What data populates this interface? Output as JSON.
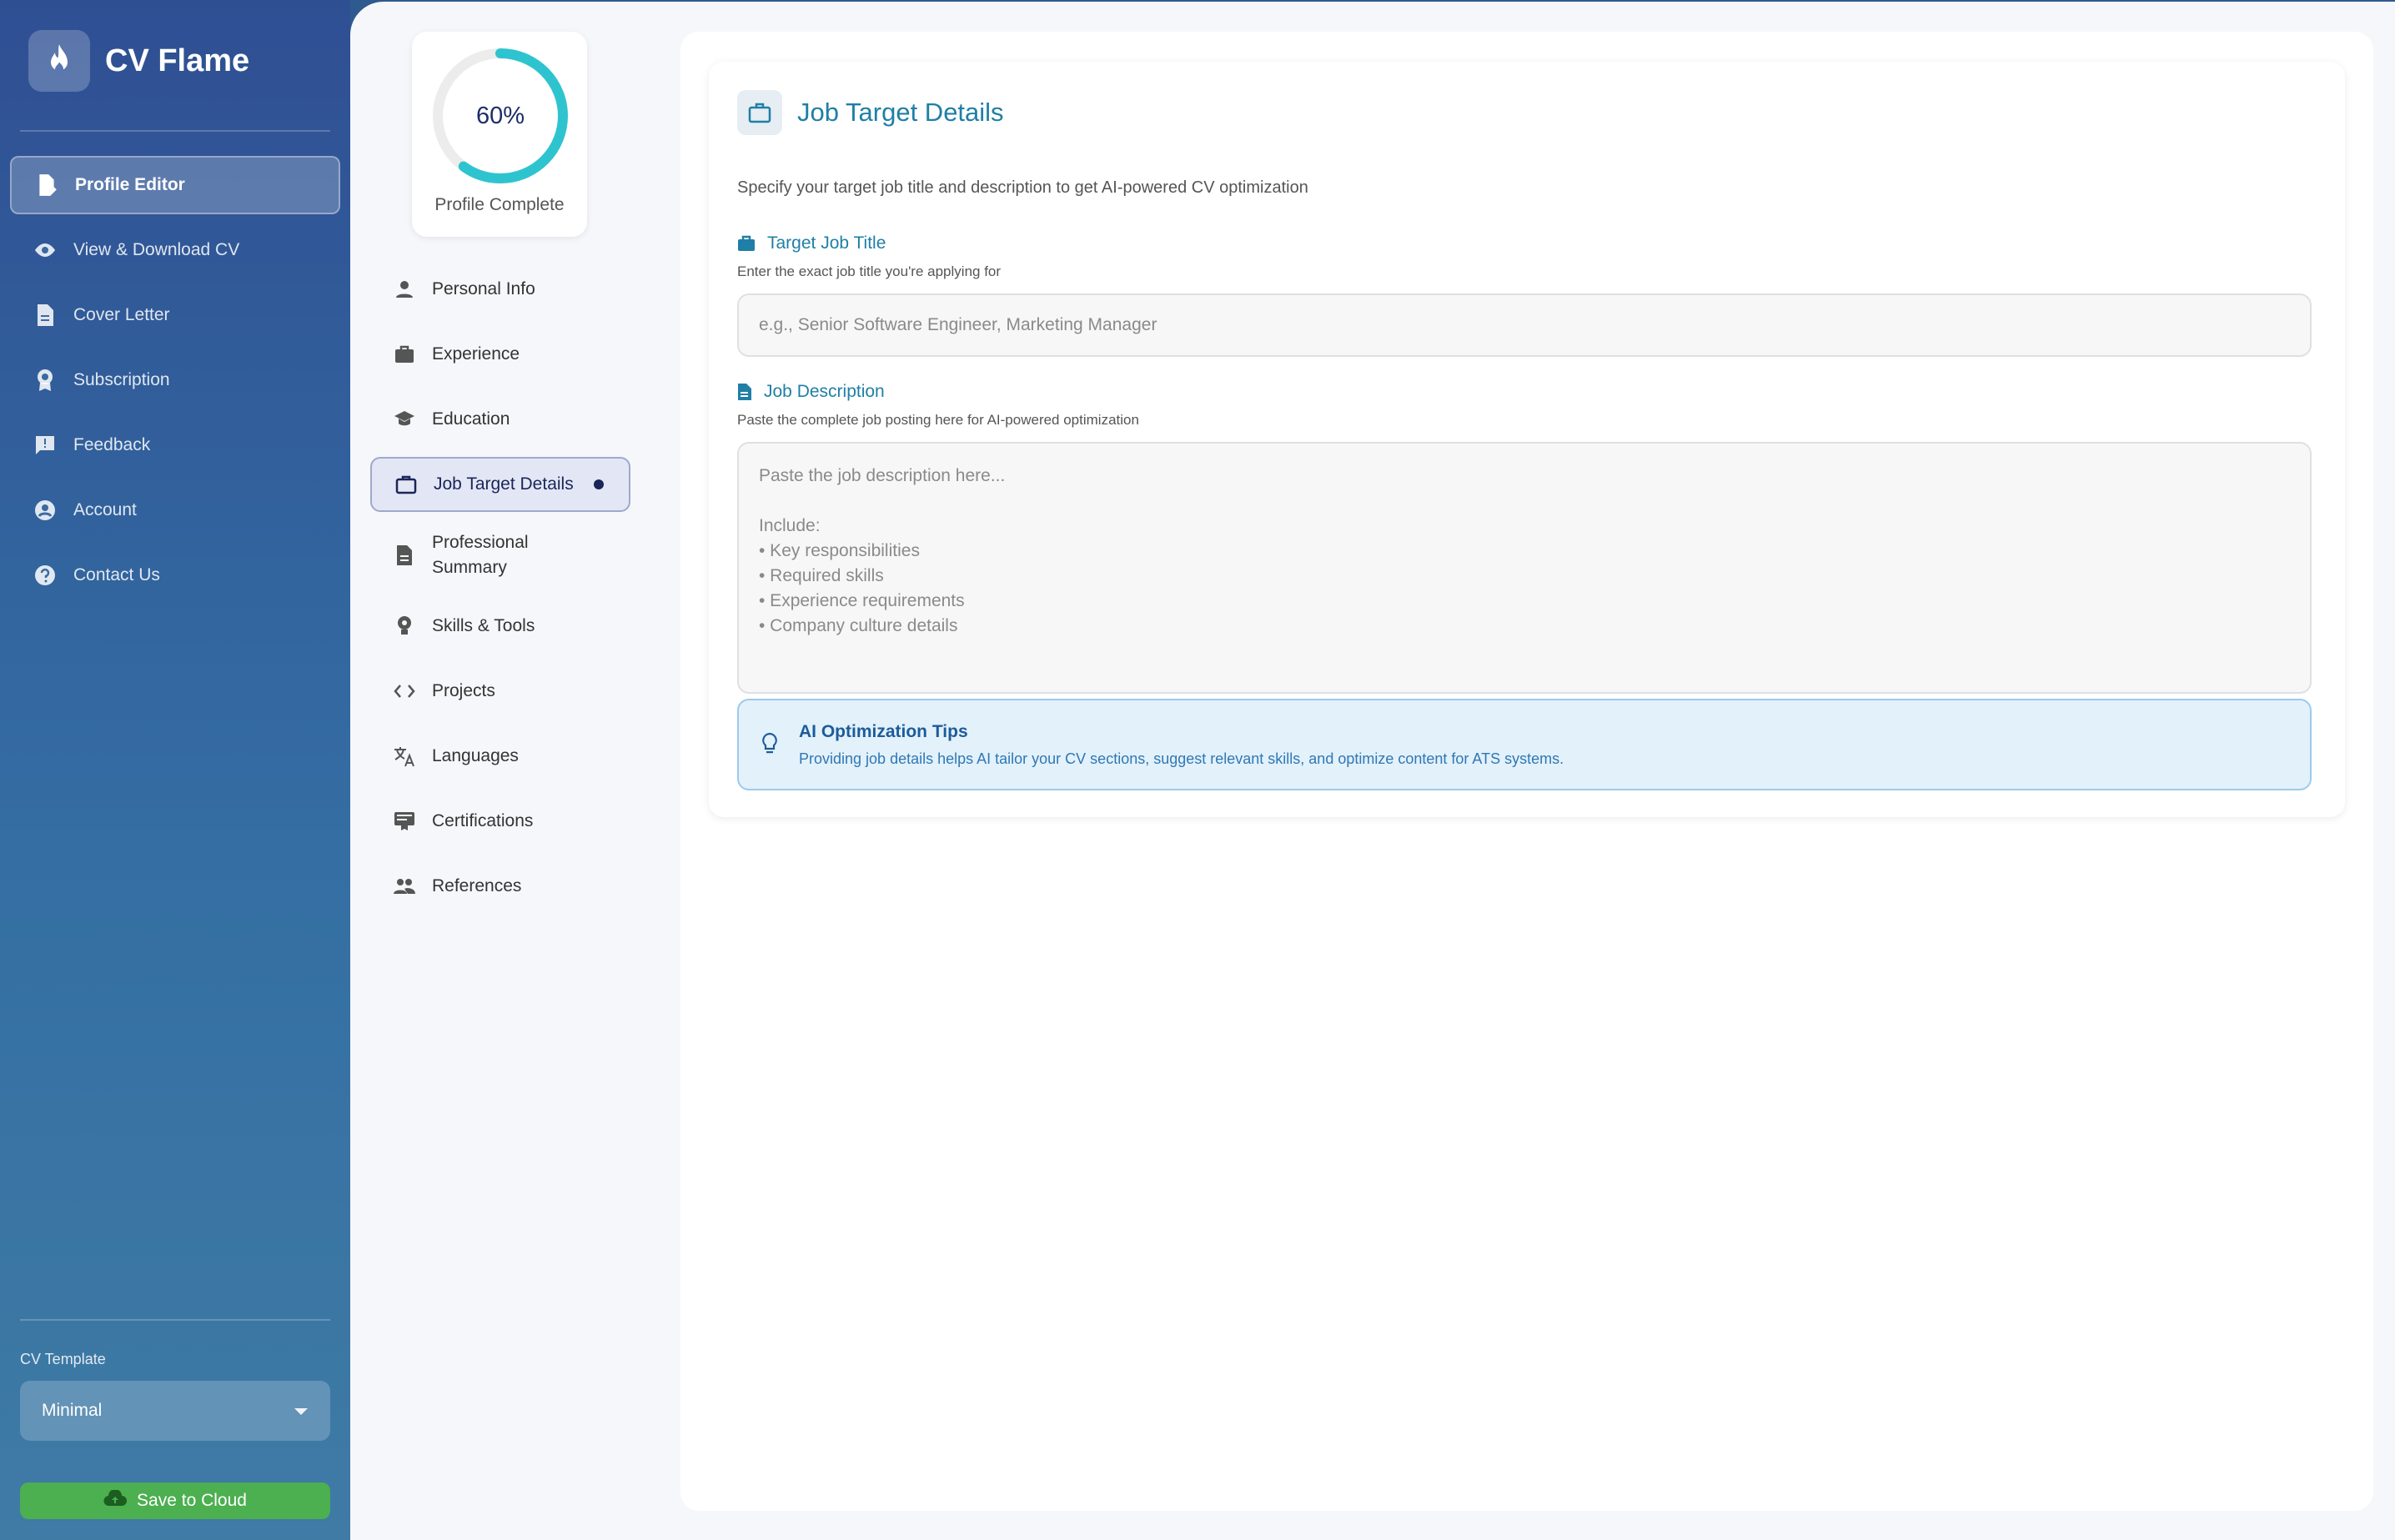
{
  "app": {
    "name": "CV Flame",
    "logo_icon": "flame-icon"
  },
  "sidebar": {
    "items": [
      {
        "label": "Profile Editor",
        "icon": "edit-document-icon",
        "active": true
      },
      {
        "label": "View & Download CV",
        "icon": "eye-icon"
      },
      {
        "label": "Cover Letter",
        "icon": "document-icon"
      },
      {
        "label": "Subscription",
        "icon": "badge-icon"
      },
      {
        "label": "Feedback",
        "icon": "feedback-icon"
      },
      {
        "label": "Account",
        "icon": "account-circle-icon"
      },
      {
        "label": "Contact Us",
        "icon": "help-circle-icon"
      }
    ],
    "template_label": "CV Template",
    "template_value": "Minimal",
    "save_label": "Save to Cloud",
    "colors": {
      "save_button": "#4caf50"
    }
  },
  "progress": {
    "value_text": "60%",
    "value": 0.6,
    "label": "Profile Complete",
    "color": "#2ec4cf"
  },
  "sections": {
    "items": [
      {
        "label": "Personal Info",
        "icon": "person-icon"
      },
      {
        "label": "Experience",
        "icon": "briefcase-icon"
      },
      {
        "label": "Education",
        "icon": "graduation-cap-icon"
      },
      {
        "label": "Job Target Details",
        "icon": "briefcase-outline-icon",
        "active": true
      },
      {
        "label": "Professional Summary",
        "icon": "document-icon"
      },
      {
        "label": "Skills & Tools",
        "icon": "lightbulb-icon"
      },
      {
        "label": "Projects",
        "icon": "code-icon"
      },
      {
        "label": "Languages",
        "icon": "translate-icon"
      },
      {
        "label": "Certifications",
        "icon": "certificate-icon"
      },
      {
        "label": "References",
        "icon": "people-icon"
      }
    ]
  },
  "form": {
    "title": "Job Target Details",
    "subtitle": "Specify your target job title and description to get AI-powered CV optimization",
    "job_title": {
      "label": "Target Job Title",
      "help": "Enter the exact job title you're applying for",
      "placeholder": "e.g., Senior Software Engineer, Marketing Manager",
      "value": ""
    },
    "job_description": {
      "label": "Job Description",
      "help": "Paste the complete job posting here for AI-powered optimization",
      "placeholder": "Paste the job description here...\n\nInclude:\n• Key responsibilities\n• Required skills\n• Experience requirements\n• Company culture details",
      "value": ""
    },
    "tips": {
      "title": "AI Optimization Tips",
      "text": "Providing job details helps AI tailor your CV sections, suggest relevant skills, and optimize content for ATS systems."
    },
    "colors": {
      "accent": "#1f7fa6",
      "tips_bg": "#e3f1fb"
    }
  }
}
